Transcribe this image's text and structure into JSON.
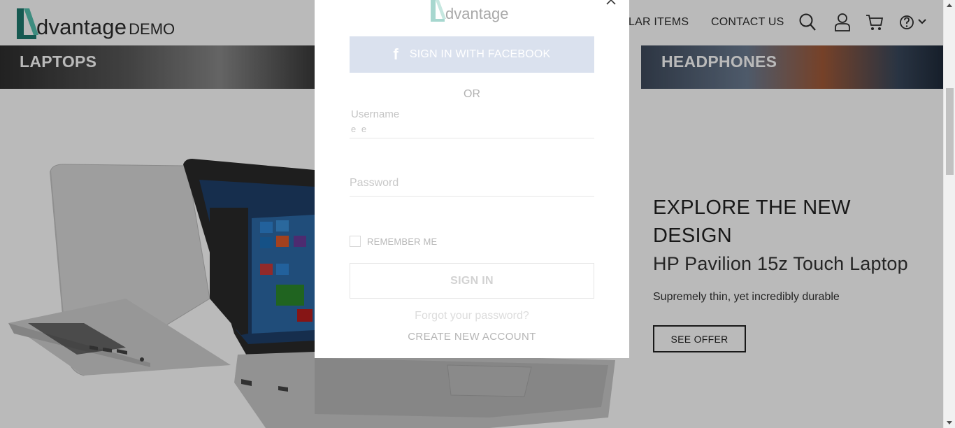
{
  "header": {
    "logo_name": "dvantage",
    "logo_suffix": "DEMO",
    "nav": {
      "popular_items": "LAR ITEMS",
      "contact_us": "CONTACT US"
    },
    "icons": [
      "search-icon",
      "user-icon",
      "cart-icon",
      "help-icon",
      "chevron-down-icon"
    ]
  },
  "categories": {
    "laptops": "LAPTOPS",
    "headphones": "HEADPHONES"
  },
  "hero": {
    "title": "EXPLORE THE NEW DESIGN",
    "product": "HP Pavilion 15z Touch Laptop",
    "description": "Supremely thin, yet incredibly durable",
    "cta": "SEE OFFER"
  },
  "login_modal": {
    "logo_name": "dvantage",
    "facebook_icon_glyph": "f",
    "facebook_label": "SIGN IN WITH FACEBOOK",
    "or_text": "OR",
    "username_label": "Username",
    "username_value": "e e",
    "password_placeholder": "Password",
    "remember_label": "REMEMBER ME",
    "remember_checked": false,
    "signin_label": "SIGN IN",
    "forgot_label": "Forgot your password?",
    "create_label": "CREATE NEW ACCOUNT"
  },
  "colors": {
    "brand_teal": "#45b7a5",
    "facebook_disabled": "#dae1ee",
    "overlay": "rgba(0,0,0,0.27)"
  }
}
